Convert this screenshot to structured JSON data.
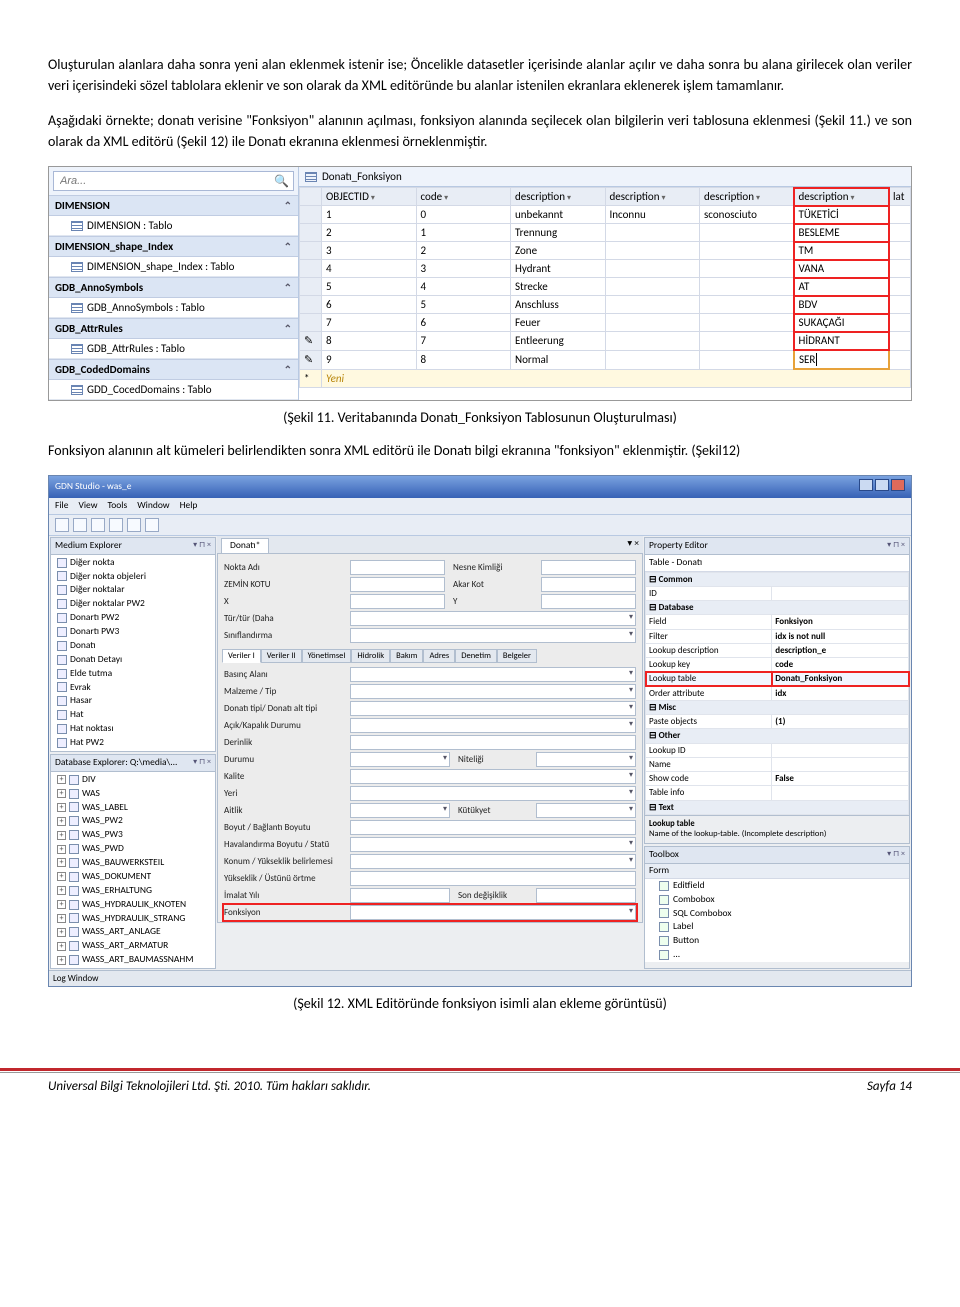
{
  "paragraphs": {
    "p1": "Oluşturulan alanlara daha sonra yeni alan eklenmek istenir ise; Öncelikle datasetler içerisinde alanlar açılır ve daha sonra bu alana girilecek olan veriler veri içerisindeki sözel tablolara eklenir ve son olarak da XML editöründe bu alanlar istenilen ekranlara eklenerek işlem tamamlanır.",
    "p2": "Aşağıdaki örnekte; donatı verisine \"Fonksiyon\" alanının açılması, fonksiyon alanında seçilecek olan bilgilerin veri tablosuna eklenmesi (Şekil 11.) ve son olarak da XML editörü (Şekil 12) ile Donatı ekranına eklenmesi örneklenmiştir.",
    "cap1": "(Şekil 11. Veritabanında Donatı_Fonksiyon Tablosunun Oluşturulması)",
    "p3": "Fonksiyon alanının alt kümeleri belirlendikten sonra XML editörü ile Donatı bilgi ekranına \"fonksiyon\"  eklenmiştir. (Şekil12)",
    "cap2": "(Şekil 12. XML Editöründe fonksiyon isimli alan ekleme görüntüsü)"
  },
  "fig1": {
    "search_placeholder": "Ara...",
    "cats": [
      {
        "name": "DIMENSION",
        "item": "DIMENSION : Tablo"
      },
      {
        "name": "DIMENSION_shape_Index",
        "item": "DIMENSION_shape_Index : Tablo"
      },
      {
        "name": "GDB_AnnoSymbols",
        "item": "GDB_AnnoSymbols : Tablo"
      },
      {
        "name": "GDB_AttrRules",
        "item": "GDB_AttrRules : Tablo"
      },
      {
        "name": "GDB_CodedDomains",
        "item": "GDD_CocedDomains : Tablo"
      }
    ],
    "tab_title": "Donatı_Fonksiyon",
    "columns": [
      "OBJECTID",
      "code",
      "description",
      "description",
      "description",
      "description"
    ],
    "last_col_hint": "lat",
    "rows": [
      {
        "id": "1",
        "code": "0",
        "d1": "unbekannt",
        "d2": "Inconnu",
        "d3": "sconosciuto",
        "d4": "TÜKETİCİ"
      },
      {
        "id": "2",
        "code": "1",
        "d1": "Trennung",
        "d2": "",
        "d3": "",
        "d4": "BESLEME"
      },
      {
        "id": "3",
        "code": "2",
        "d1": "Zone",
        "d2": "",
        "d3": "",
        "d4": "TM"
      },
      {
        "id": "4",
        "code": "3",
        "d1": "Hydrant",
        "d2": "",
        "d3": "",
        "d4": "VANA"
      },
      {
        "id": "5",
        "code": "4",
        "d1": "Strecke",
        "d2": "",
        "d3": "",
        "d4": "AT"
      },
      {
        "id": "6",
        "code": "5",
        "d1": "Anschluss",
        "d2": "",
        "d3": "",
        "d4": "BDV"
      },
      {
        "id": "7",
        "code": "6",
        "d1": "Feuer",
        "d2": "",
        "d3": "",
        "d4": "SUKAÇAĞI"
      },
      {
        "id": "8",
        "code": "7",
        "d1": "Entleerung",
        "d2": "",
        "d3": "",
        "d4": "HİDRANT"
      },
      {
        "id": "9",
        "code": "8",
        "d1": "Normal",
        "d2": "",
        "d3": "",
        "d4": "SER"
      }
    ],
    "star_label": "Yeni",
    "star_mark": "*"
  },
  "fig2": {
    "title": "GDN Studio - was_e",
    "menus": [
      "File",
      "View",
      "Tools",
      "Window",
      "Help"
    ],
    "panels": {
      "medium_explorer": "Medium Explorer",
      "db_explorer": "Database Explorer: Q:\\media\\...",
      "center_tab": "Donatı*",
      "property_editor": "Property Editor",
      "prop_sub": "Table - Donatı",
      "toolbox": "Toolbox",
      "toolbox_cat": "Form",
      "log": "Log Window"
    },
    "tree1": [
      "Diğer nokta",
      "Diğer nokta objeleri",
      "Diğer noktalar",
      "Diğer noktalar PW2",
      "Donartı PW2",
      "Donartı PW3",
      "Donatı",
      "Donatı Detayı",
      "Elde tutma",
      "Evrak",
      "Hasar",
      "Hat",
      "Hat noktası",
      "Hat PW2"
    ],
    "tree2": [
      "DIV",
      "WAS",
      "WAS_LABEL",
      "WAS_PW2",
      "WAS_PW3",
      "WAS_PWD",
      "WAS_BAUWERKSTEIL",
      "WAS_DOKUMENT",
      "WAS_ERHALTUNG",
      "WAS_HYDRAULIK_KNOTEN",
      "WAS_HYDRAULIK_STRANG",
      "WASS_ART_ANLAGE",
      "WASS_ART_ARMATUR",
      "WASS_ART_BAUMASSNAHM"
    ],
    "form_top": [
      [
        "Nokta Adı",
        "Nesne Kimliği"
      ],
      [
        "ZEMİN KOTU",
        "Akar Kot"
      ],
      [
        "X",
        "Y"
      ]
    ],
    "form_top_single": [
      "Tür/tür (Daha",
      "Sınıflandırma"
    ],
    "tabs2": [
      "Veriler I",
      "Veriler II",
      "Yönetimsel",
      "Hidrolik",
      "Bakım",
      "Adres",
      "Denetim",
      "Belgeler"
    ],
    "form_fields": [
      {
        "l": "Basınç Alanı",
        "t": "combo"
      },
      {
        "l": "Malzeme / Tip",
        "t": "combo"
      },
      {
        "l": "Donatı tipi/ Donatı alt tipi",
        "t": "combo"
      },
      {
        "l": "Açık/Kapalık Durumu",
        "t": "combo"
      },
      {
        "l": "Derinlik",
        "t": "text"
      },
      {
        "l": "Durumu",
        "t": "combo",
        "r": "Niteliği"
      },
      {
        "l": "Kalite",
        "t": "combo"
      },
      {
        "l": "Yeri",
        "t": "combo"
      },
      {
        "l": "Aitlik",
        "t": "combo",
        "r": "Kütükyet"
      },
      {
        "l": "Boyut / Bağlantı Boyutu",
        "t": "text"
      },
      {
        "l": "Havalandırma Boyutu / Statü",
        "t": "combo"
      },
      {
        "l": "Konum / Yükseklik belirlemesi",
        "t": "combo"
      },
      {
        "l": "Yükseklik / Üstünü örtme",
        "t": "text"
      },
      {
        "l": "İmalat Yılı",
        "t": "text",
        "r": "Son değişiklik"
      },
      {
        "l": "Fonksiyon",
        "t": "combo",
        "hl": true
      }
    ],
    "props": [
      {
        "cat": "Common"
      },
      {
        "k": "ID",
        "v": ""
      },
      {
        "cat": "Database"
      },
      {
        "k": "Field",
        "v": "Fonksiyon"
      },
      {
        "k": "Filter",
        "v": "idx is not null"
      },
      {
        "k": "Lookup description",
        "v": "description_e"
      },
      {
        "k": "Lookup key",
        "v": "code"
      },
      {
        "k": "Lookup table",
        "v": "Donatı_Fonksiyon",
        "hl": true
      },
      {
        "k": "Order attribute",
        "v": "idx"
      },
      {
        "cat": "Misc"
      },
      {
        "k": "Paste objects",
        "v": "(1)"
      },
      {
        "cat": "Other"
      },
      {
        "k": "Lookup ID",
        "v": ""
      },
      {
        "k": "Name",
        "v": ""
      },
      {
        "k": "Show code",
        "v": "False"
      },
      {
        "k": "Table info",
        "v": ""
      },
      {
        "cat": "Text"
      }
    ],
    "prop_desc_title": "Lookup table",
    "prop_desc_text": "Name of the lookup-table. (Incomplete description)",
    "toolbox_items": [
      "Editfield",
      "Combobox",
      "SQL Combobox",
      "Label",
      "Button",
      "..."
    ]
  },
  "footer": {
    "left": "Universal Bilgi Teknolojileri Ltd. Şti. 2010. Tüm hakları saklıdır.",
    "right": "Sayfa 14"
  }
}
